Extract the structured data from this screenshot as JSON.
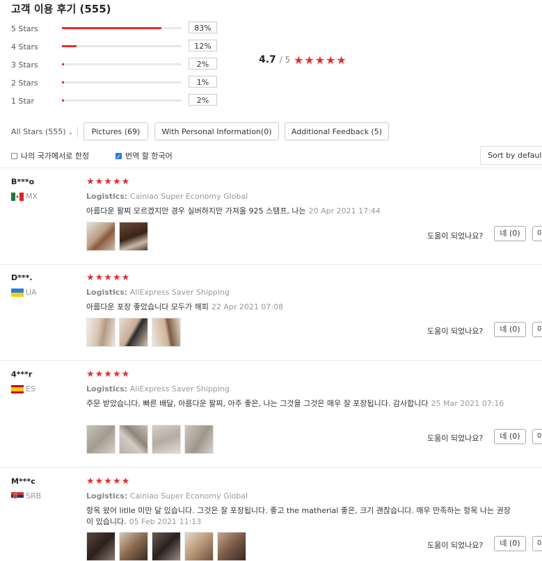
{
  "header": {
    "title": "고객 이용 후기 (555)"
  },
  "ratings": [
    {
      "label": "5 Stars",
      "pct": "83%",
      "fraction": 0.83
    },
    {
      "label": "4 Stars",
      "pct": "12%",
      "fraction": 0.12
    },
    {
      "label": "3 Stars",
      "pct": "2%",
      "fraction": 0.02
    },
    {
      "label": "2 Stars",
      "pct": "1%",
      "fraction": 0.01
    },
    {
      "label": "1 Star",
      "pct": "2%",
      "fraction": 0.02
    }
  ],
  "summary": {
    "score": "4.7",
    "out_of": "/ 5",
    "stars": "★★★★★"
  },
  "filters": {
    "all_stars": "All Stars (555)",
    "pictures": "Pictures (69)",
    "personal": "With Personal Information(0)",
    "additional": "Additional Feedback (5)"
  },
  "options": {
    "country_only": "나의 국가에서로 한정",
    "translate": "번역 할 한국어",
    "sort": "Sort by default"
  },
  "helpful_label": "도움이 되었나요?",
  "reviews": [
    {
      "name": "B***o",
      "country": "MX",
      "stars": "★★★★★",
      "logistics_label": "Logistics:",
      "logistics": "Cainiao Super Economy Global",
      "text": "아름다운 팔찌 모르겠지만 경우 실버하지만 가져올 925 스탬프, 나는",
      "date": "20 Apr 2021 17:44",
      "yes": "네 (0)",
      "no": "아"
    },
    {
      "name": "D***.",
      "country": "UA",
      "stars": "★★★★★",
      "logistics_label": "Logistics:",
      "logistics": "AliExpress Saver Shipping",
      "text": "아름다운 포장 좋았습니다 모두가 해피",
      "date": "22 Apr 2021 07:08",
      "yes": "네 (0)",
      "no": "아"
    },
    {
      "name": "4***r",
      "country": "ES",
      "stars": "★★★★★",
      "logistics_label": "Logistics:",
      "logistics": "AliExpress Saver Shipping",
      "text": "주문 받았습니다, 빠른 배달, 아름다운 팔찌, 아주 좋은, 나는 그것을 그것은 매우 잘 포장됩니다. 감사합니다",
      "date": "25 Mar 2021 07:16",
      "yes": "네 (0)",
      "no": "아"
    },
    {
      "name": "M***c",
      "country": "SRB",
      "stars": "★★★★★",
      "logistics_label": "Logistics:",
      "logistics": "Cainiao Super Economy Global",
      "text": "항목 왔어 litlle 미만 달 있습니다. 그것은 잘 포장됩니다. 좋고 the matherial 좋은, 크기 괜찮습니다. 매우 만족하는 항목 나는 권장 이 있습니다.",
      "date": "05 Feb 2021 11:13",
      "yes": "네 (0)",
      "no": "아"
    }
  ],
  "colors": {
    "accent": "#e62e2e",
    "bar_bg": "#e8e8e8",
    "checkbox": "#2f7bd8"
  }
}
